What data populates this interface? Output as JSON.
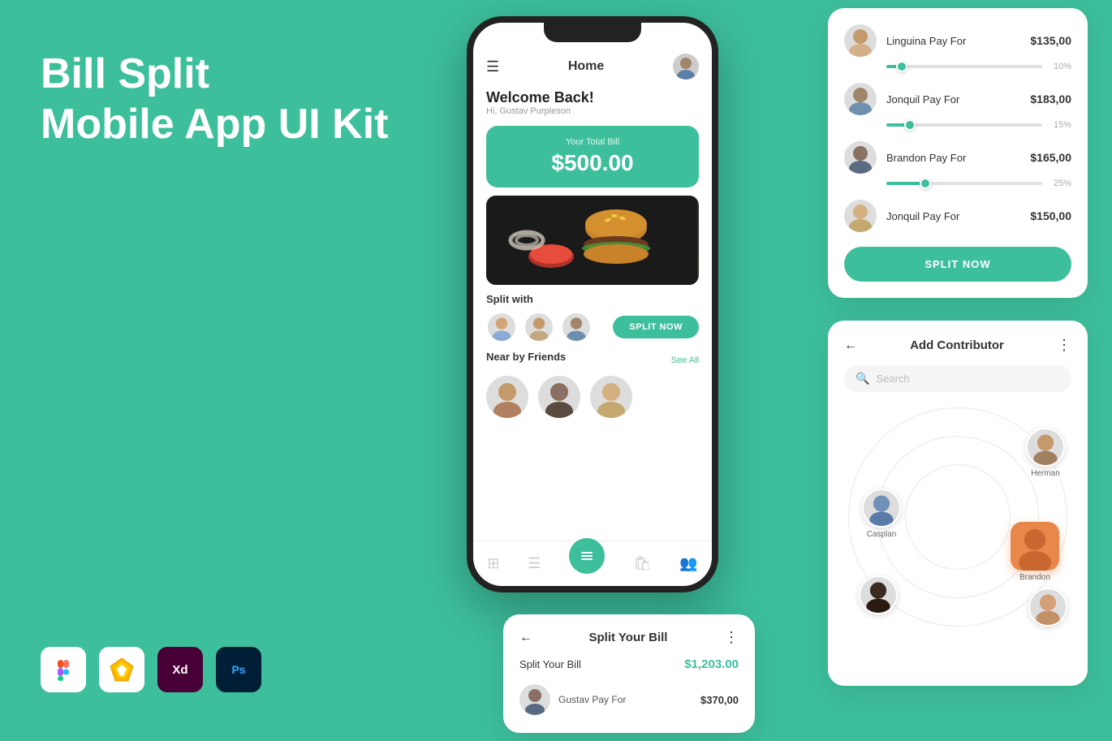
{
  "app": {
    "title_line1": "Bill Split",
    "title_line2": "Mobile App UI Kit",
    "bg_color": "#3dbf9c"
  },
  "phone": {
    "header_title": "Home",
    "welcome_heading": "Welcome Back!",
    "welcome_sub": "Hi, Gustav Purpleson",
    "bill_label": "Your Total Bill",
    "bill_amount": "$500.00",
    "split_with_label": "Split with",
    "split_now_label": "SPLIT NOW",
    "nearby_label": "Near by Friends",
    "see_all": "See All"
  },
  "split_bill_panel": {
    "persons": [
      {
        "name": "Linguina Pay For",
        "amount": "$135,00",
        "pct": "10%",
        "fill_width": 10
      },
      {
        "name": "Jonquil Pay For",
        "amount": "$183,00",
        "pct": "15%",
        "fill_width": 15
      },
      {
        "name": "Brandon Pay For",
        "amount": "$165,00",
        "pct": "25%",
        "fill_width": 25
      },
      {
        "name": "Jonquil Pay For",
        "amount": "$150,00",
        "pct": null,
        "fill_width": 0
      }
    ],
    "split_now_label": "SPLIT NOW"
  },
  "add_contributor": {
    "title": "Add Contributor",
    "search_placeholder": "Search",
    "persons": [
      {
        "name": "Casplan",
        "pos": "left-center"
      },
      {
        "name": "Herman",
        "pos": "top-right"
      },
      {
        "name": "Brandon",
        "pos": "center",
        "selected": true
      }
    ]
  },
  "split_your_bill": {
    "title": "Split Your Bill",
    "total_label": "Split Your Bill",
    "total_amount": "$1,203.00",
    "persons": [
      {
        "name": "Gustav Pay For",
        "amount": "$370,00"
      }
    ]
  },
  "tools": [
    {
      "name": "Figma",
      "label": "F"
    },
    {
      "name": "Sketch",
      "label": "S"
    },
    {
      "name": "Adobe XD",
      "label": "Xd"
    },
    {
      "name": "Photoshop",
      "label": "Ps"
    }
  ]
}
